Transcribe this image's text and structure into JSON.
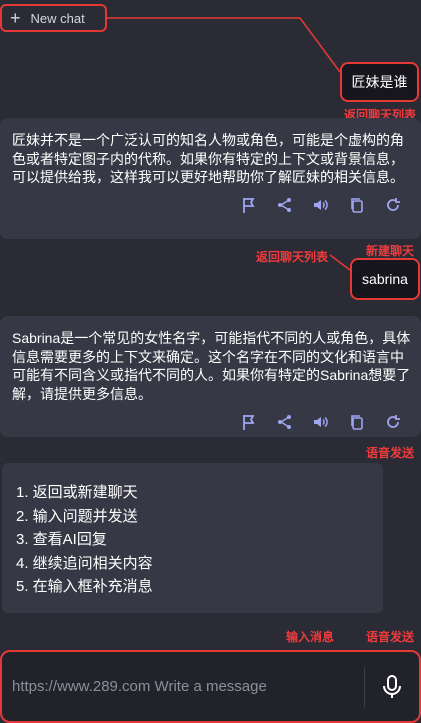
{
  "header": {
    "new_chat_label": "New chat"
  },
  "messages": {
    "user1": "匠妹是谁",
    "ai1": "匠妹并不是一个广泛认可的知名人物或角色，可能是个虚构的角色或者特定图子内的代称。如果你有特定的上下文或背景信息，可以提供给我，这样我可以更好地帮助你了解匠妹的相关信息。",
    "user2": "sabrina",
    "ai2": "Sabrina是一个常见的女性名字，可能指代不同的人或角色，具体信息需要更多的上下文来确定。这个名字在不同的文化和语言中可能有不同含义或指代不同的人。如果你有特定的Sabrina想要了解，请提供更多信息。"
  },
  "annotations": {
    "back_list_1": "返回聊天列表",
    "back_list_2": "返回聊天列表",
    "new_chat": "新建聊天",
    "voice_send_1": "语音发送",
    "input_msg": "输入消息",
    "voice_send_2": "语音发送"
  },
  "steps": [
    "1. 返回或新建聊天",
    "2. 输入问题并发送",
    "3. 查看AI回复",
    "4. 继续追问相关内容",
    "5. 在输入框补充消息"
  ],
  "input": {
    "placeholder": "https://www.289.com Write a message"
  },
  "icons": [
    "plus-icon",
    "flag-icon",
    "share-icon",
    "volume-icon",
    "copy-icon",
    "refresh-icon",
    "mic-icon"
  ],
  "colors": {
    "annotation": "#e53935",
    "background": "#2b2b36",
    "card": "#373845"
  }
}
